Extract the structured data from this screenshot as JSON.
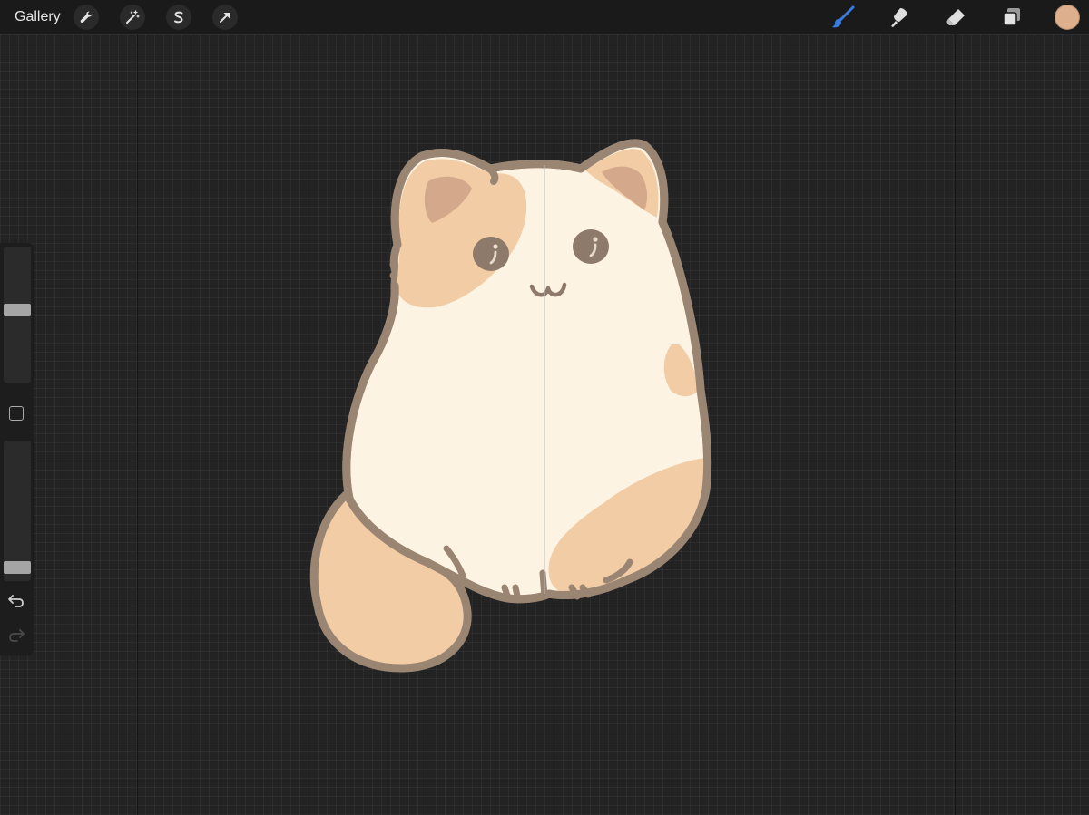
{
  "topbar": {
    "gallery_label": "Gallery",
    "left_tools": [
      {
        "icon": "wrench-icon",
        "name": "actions"
      },
      {
        "icon": "magic-wand-icon",
        "name": "adjustments"
      },
      {
        "icon": "selection-s-icon",
        "name": "selection"
      },
      {
        "icon": "arrow-cursor-icon",
        "name": "transform"
      }
    ],
    "right_tools": [
      {
        "icon": "brush-icon",
        "name": "paint",
        "active": true
      },
      {
        "icon": "smudge-icon",
        "name": "smudge"
      },
      {
        "icon": "eraser-icon",
        "name": "erase"
      },
      {
        "icon": "layers-icon",
        "name": "layers"
      }
    ],
    "current_color": "#DDAF8C",
    "active_tool_color": "#3B7BE0"
  },
  "sidebar": {
    "brush_size": 0.54,
    "brush_opacity": 0.06,
    "undo_icon": "undo-arrow-icon",
    "redo_icon": "redo-arrow-icon"
  },
  "canvas": {
    "colors": {
      "background": "#232323",
      "outline": "#9A8573",
      "body_fill": "#FDF3E2",
      "patch_fill": "#F1CCA5",
      "ear_inner": "#D4A88A",
      "eye": "#8E7A6A"
    }
  }
}
